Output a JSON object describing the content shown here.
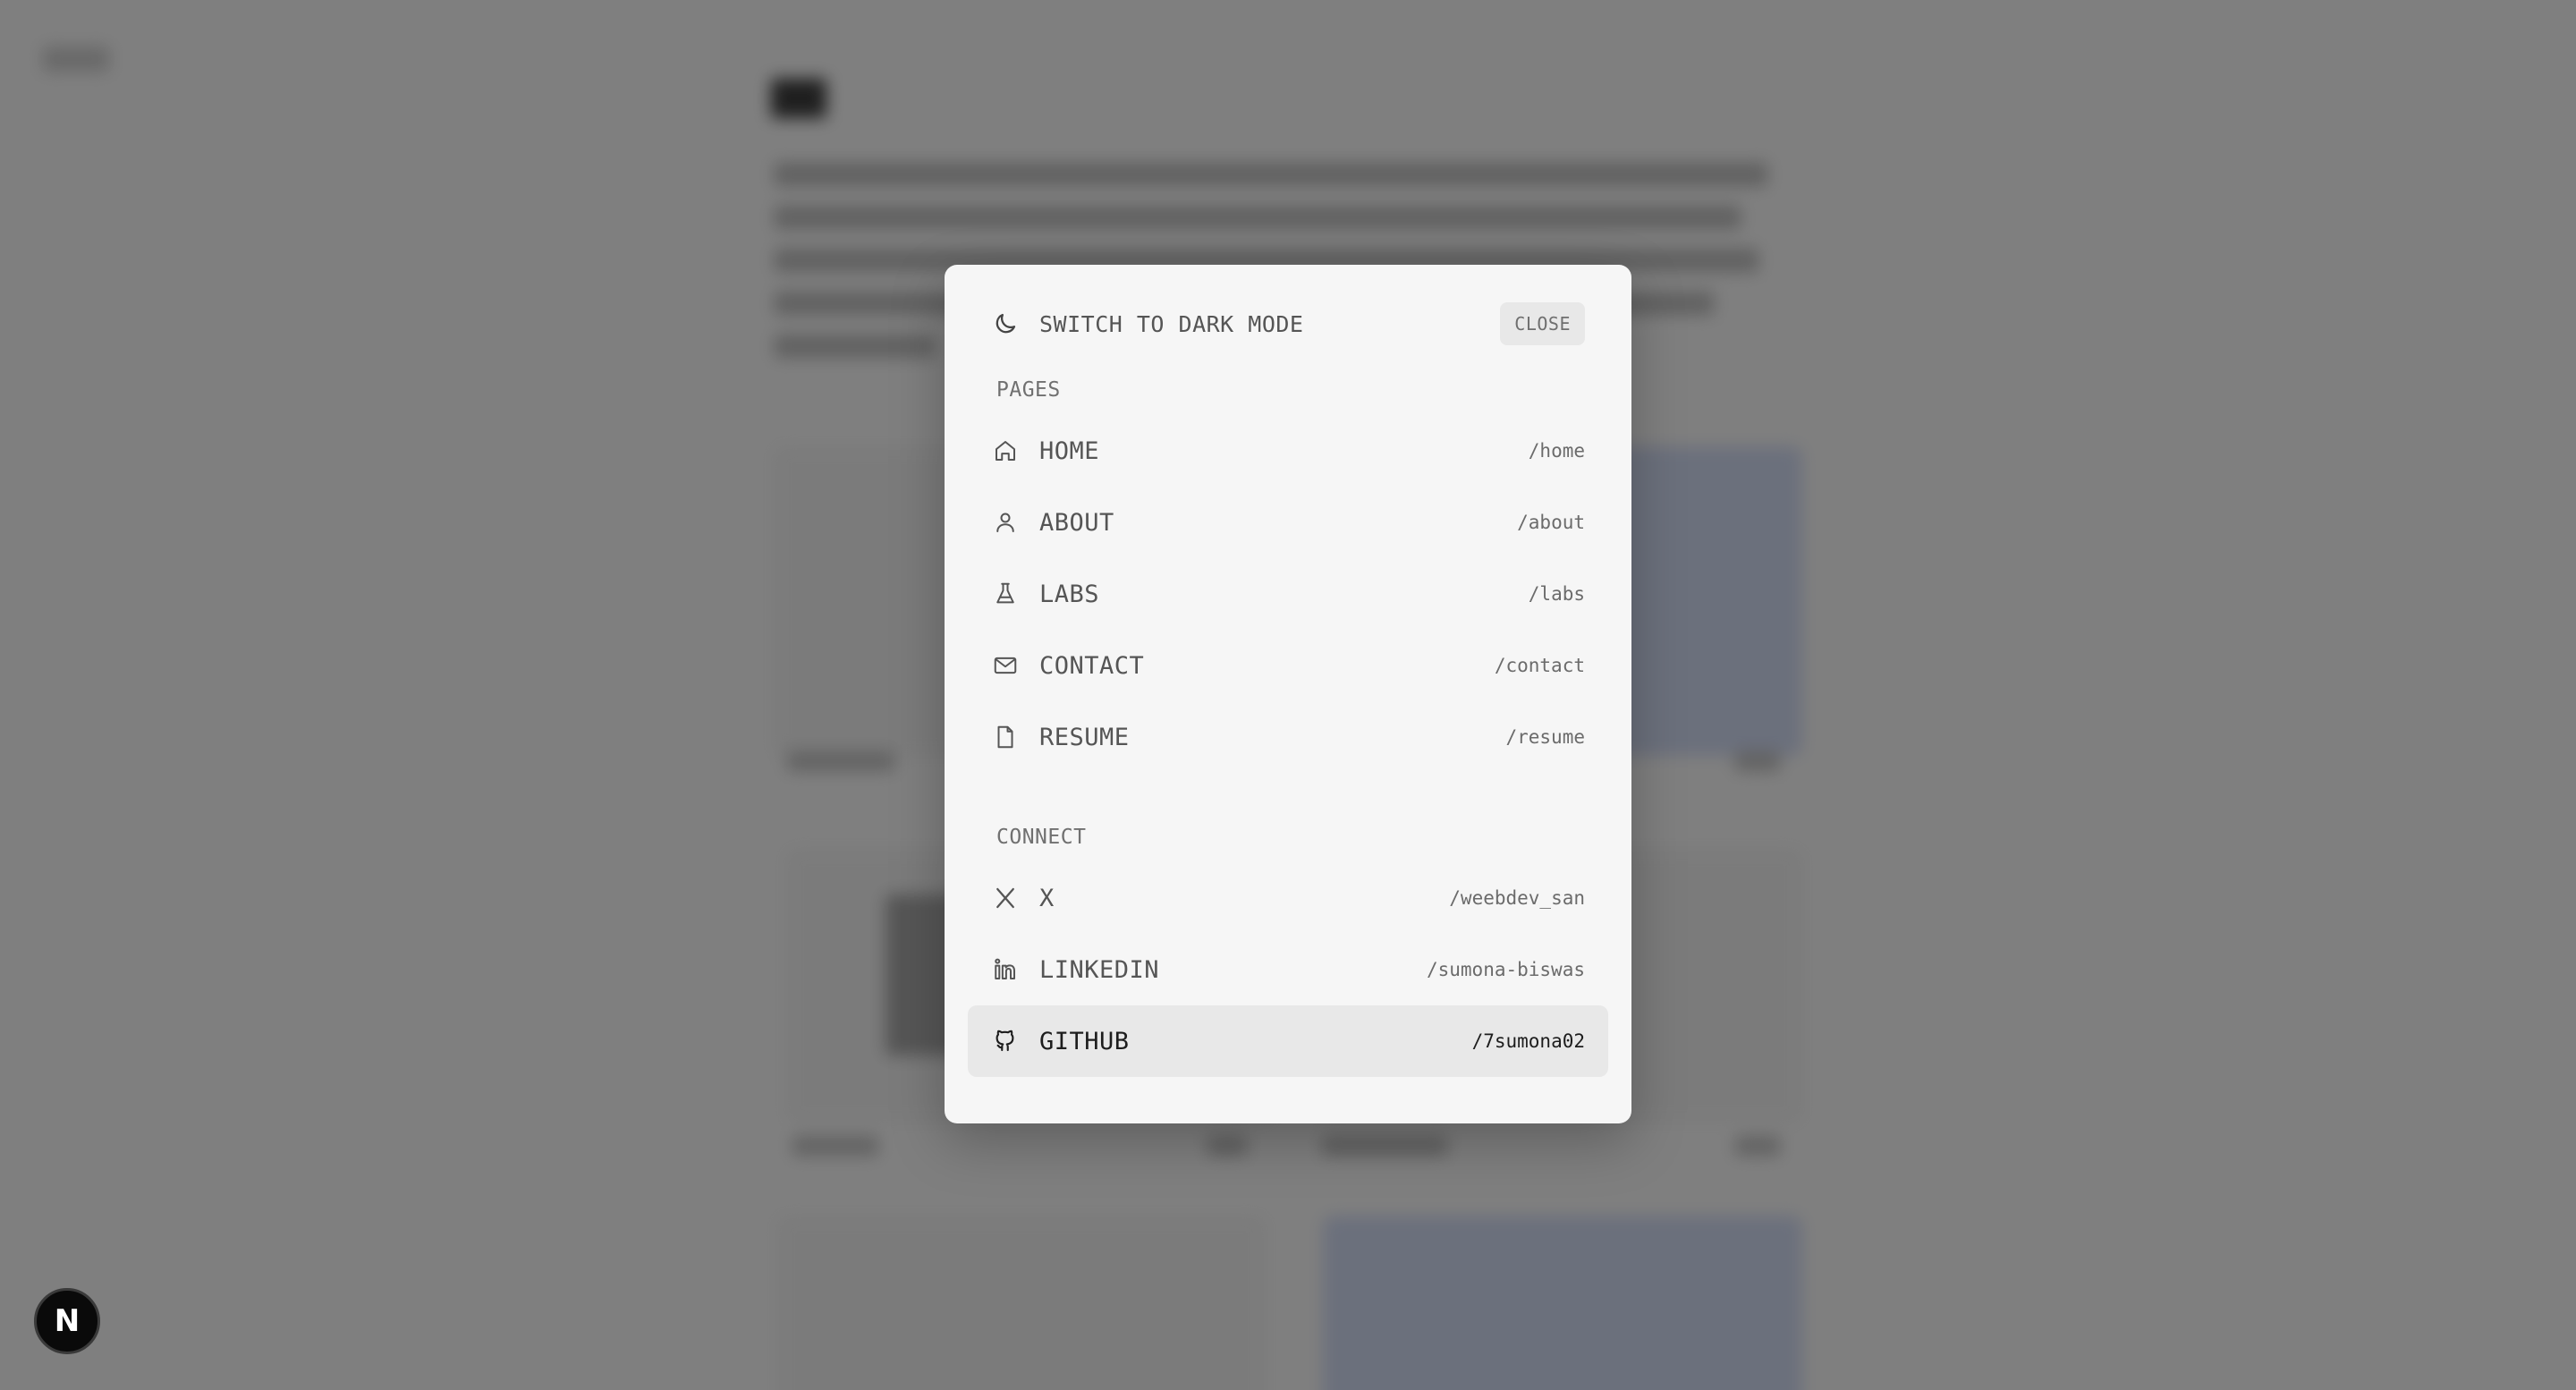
{
  "palette": {
    "theme_toggle_label": "SWITCH TO DARK MODE",
    "close_label": "CLOSE",
    "pages_heading": "PAGES",
    "pages": [
      {
        "label": "HOME",
        "path": "/home",
        "icon": "home-icon"
      },
      {
        "label": "ABOUT",
        "path": "/about",
        "icon": "user-icon"
      },
      {
        "label": "LABS",
        "path": "/labs",
        "icon": "flask-icon"
      },
      {
        "label": "CONTACT",
        "path": "/contact",
        "icon": "mail-icon"
      },
      {
        "label": "RESUME",
        "path": "/resume",
        "icon": "file-icon"
      }
    ],
    "connect_heading": "CONNECT",
    "connect": [
      {
        "label": "X",
        "path": "/weebdev_san",
        "icon": "x-logo-icon"
      },
      {
        "label": "LINKEDIN",
        "path": "/sumona-biswas",
        "icon": "linkedin-icon"
      },
      {
        "label": "GITHUB",
        "path": "/7sumona02",
        "icon": "github-icon",
        "active": true
      }
    ]
  },
  "next_badge": {
    "label": "N"
  },
  "colors": {
    "overlay": "#7a7a7a",
    "palette_bg": "#f6f6f6",
    "active_row_bg": "#e8e8e8",
    "badge_bg": "#0a0a0a"
  }
}
